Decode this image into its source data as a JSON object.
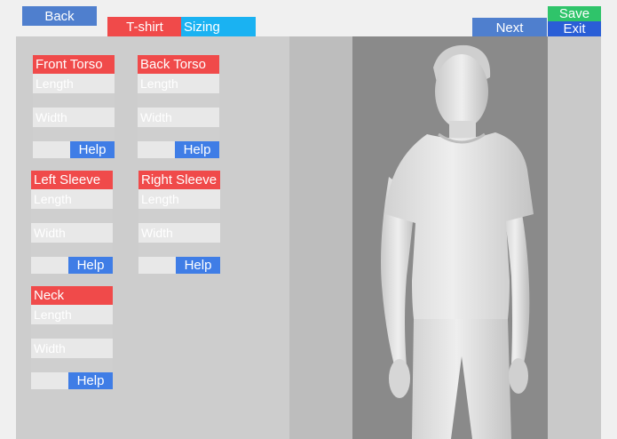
{
  "header": {
    "back_label": "Back",
    "tabs": [
      {
        "label": "T-shirt"
      },
      {
        "label": "Sizing"
      }
    ],
    "next_label": "Next",
    "save_label": "Save",
    "exit_label": "Exit"
  },
  "panels": [
    {
      "title": "Front Torso",
      "length_placeholder": "Length",
      "width_placeholder": "Width",
      "help_label": "Help"
    },
    {
      "title": "Back Torso",
      "length_placeholder": "Length",
      "width_placeholder": "Width",
      "help_label": "Help"
    },
    {
      "title": "Left Sleeve",
      "length_placeholder": "Length",
      "width_placeholder": "Width",
      "help_label": "Help"
    },
    {
      "title": "Right Sleeve",
      "length_placeholder": "Length",
      "width_placeholder": "Width",
      "help_label": "Help"
    },
    {
      "title": "Neck",
      "length_placeholder": "Length",
      "width_placeholder": "Width",
      "help_label": "Help"
    }
  ],
  "colors": {
    "title_bar": "#f04a4a",
    "help_button": "#3f7de6",
    "back_button": "#4f7fce",
    "sizing_tab": "#1ab2f2",
    "save_button": "#2fc46a",
    "exit_button": "#2a5ed6"
  }
}
